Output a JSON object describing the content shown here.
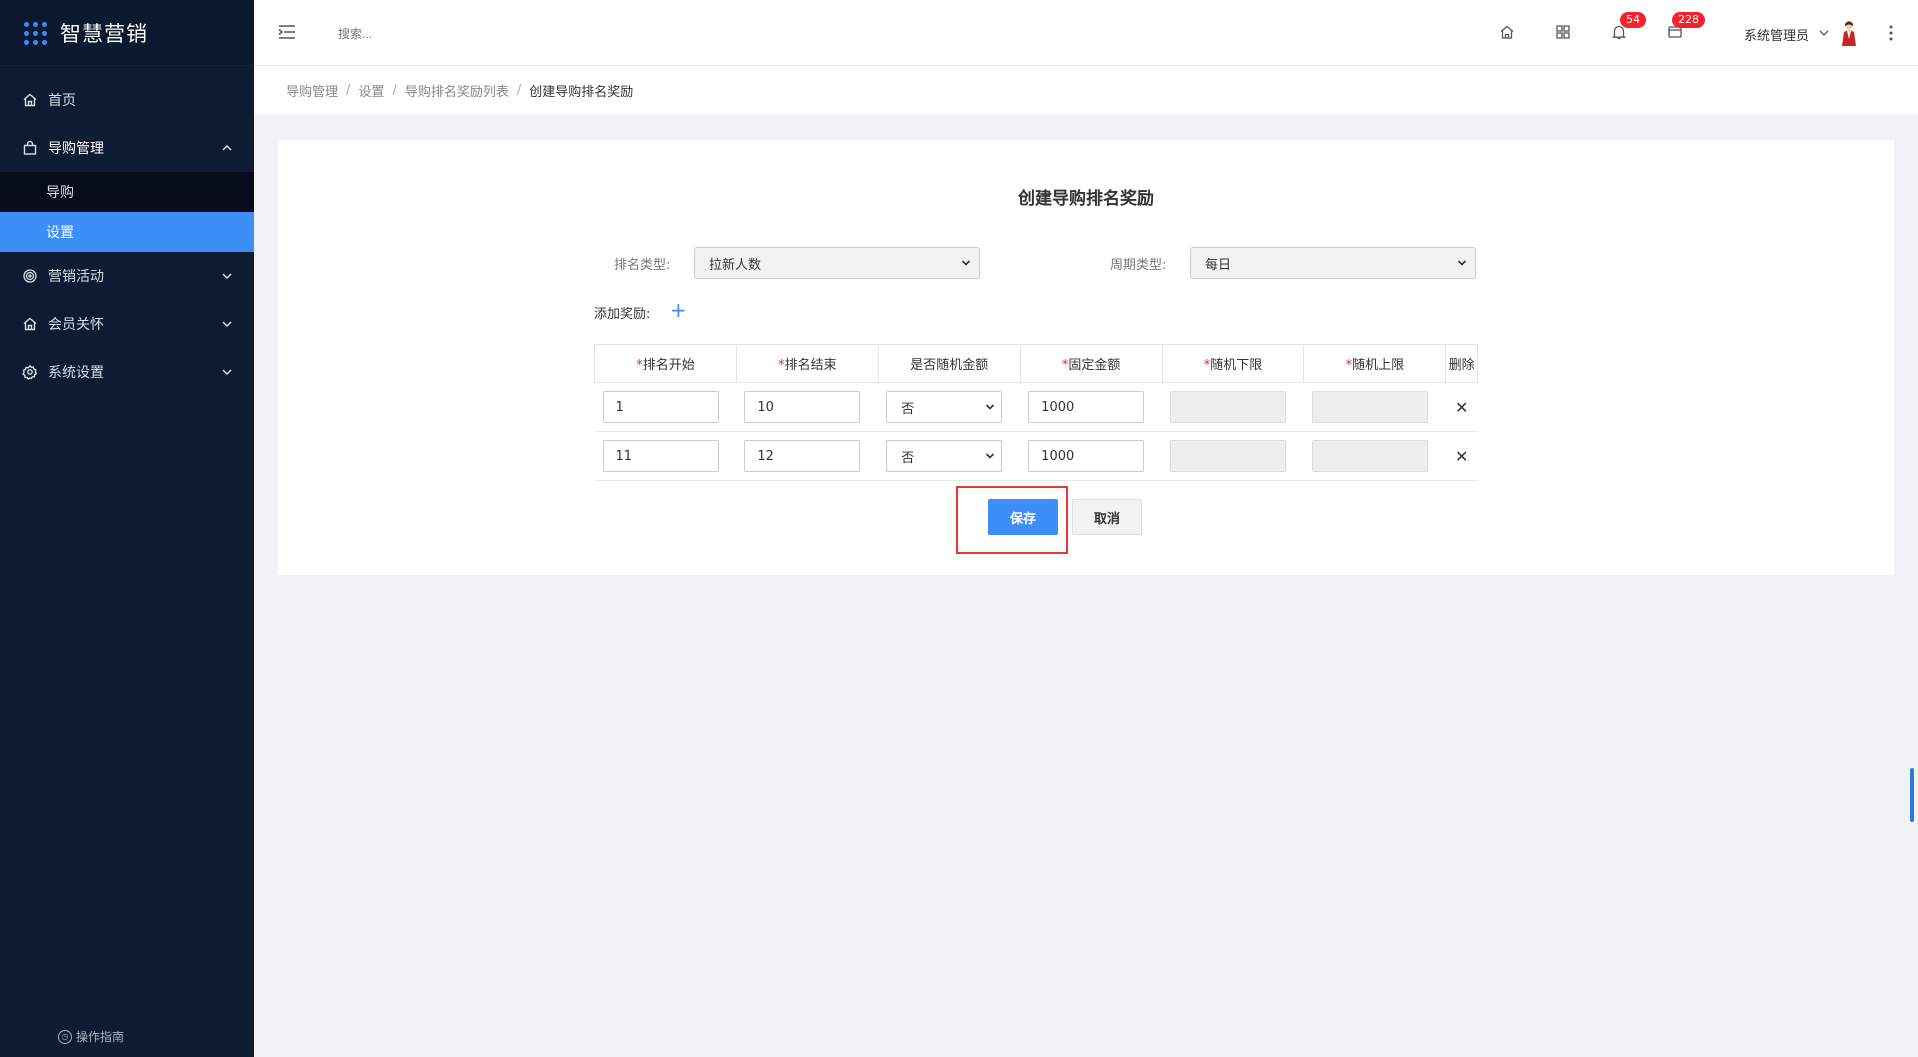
{
  "app": {
    "title": "智慧营销"
  },
  "sidebar": {
    "items": [
      {
        "label": "首页",
        "icon": "home-icon"
      },
      {
        "label": "导购管理",
        "icon": "bag-icon",
        "expanded": true,
        "children": [
          {
            "label": "导购",
            "selected": false
          },
          {
            "label": "设置",
            "selected": true
          }
        ]
      },
      {
        "label": "营销活动",
        "icon": "target-icon"
      },
      {
        "label": "会员关怀",
        "icon": "house-icon"
      },
      {
        "label": "系统设置",
        "icon": "gear-icon"
      }
    ],
    "guide_label": "操作指南"
  },
  "header": {
    "search_placeholder": "搜索...",
    "notification_count": "54",
    "message_count": "228",
    "user_name": "系统管理员"
  },
  "breadcrumb": [
    "导购管理",
    "设置",
    "导购排名奖励列表",
    "创建导购排名奖励"
  ],
  "form": {
    "title": "创建导购排名奖励",
    "rank_type_label": "排名类型:",
    "rank_type_value": "拉新人数",
    "period_type_label": "周期类型:",
    "period_type_value": "每日",
    "add_reward_label": "添加奖励:",
    "add_icon": "plus-icon"
  },
  "table": {
    "columns": [
      {
        "label": "排名开始",
        "required": true
      },
      {
        "label": "排名结束",
        "required": true
      },
      {
        "label": "是否随机金额",
        "required": false
      },
      {
        "label": "固定金额",
        "required": true
      },
      {
        "label": "随机下限",
        "required": true
      },
      {
        "label": "随机上限",
        "required": true
      },
      {
        "label": "删除",
        "required": false
      }
    ],
    "required_mark": "*",
    "rows": [
      {
        "start": "1",
        "end": "10",
        "random": "否",
        "fixed": "1000",
        "min": "",
        "max": "",
        "delete": "✕"
      },
      {
        "start": "11",
        "end": "12",
        "random": "否",
        "fixed": "1000",
        "min": "",
        "max": "",
        "delete": "✕"
      }
    ]
  },
  "actions": {
    "save_label": "保存",
    "cancel_label": "取消"
  },
  "colors": {
    "primary": "#3d8ef8",
    "sidebar_bg": "#0e1b33",
    "badge": "#f5222d",
    "highlight": "#e53935"
  }
}
